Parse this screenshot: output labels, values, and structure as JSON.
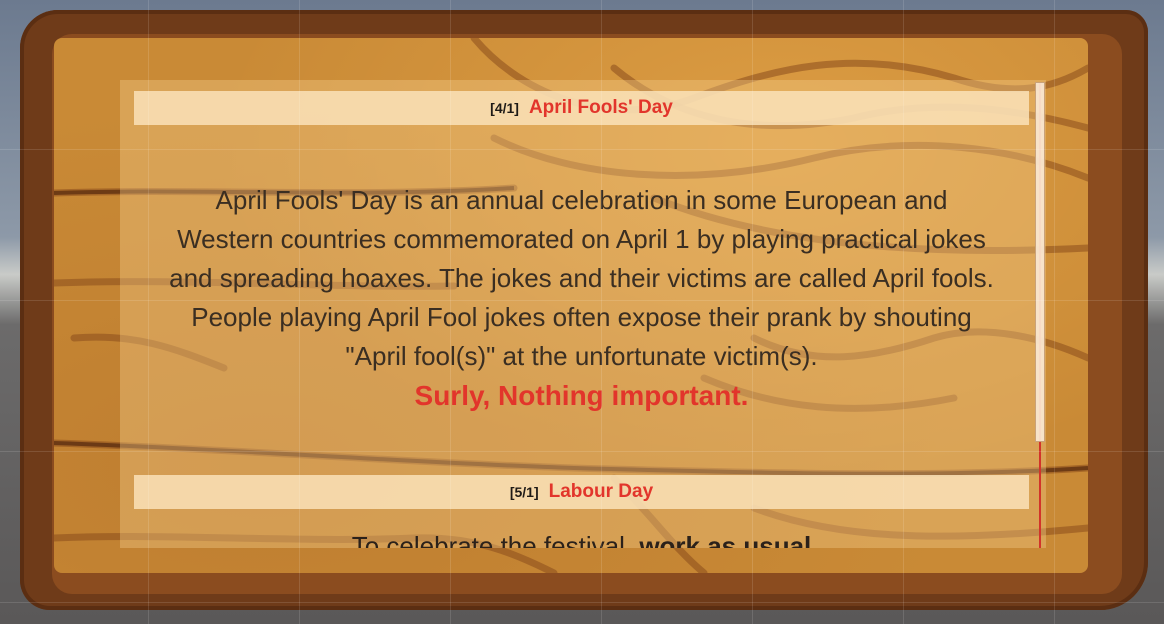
{
  "entries": [
    {
      "date": "[4/1]",
      "title": "April Fools' Day",
      "lines": [
        "April Fools' Day is an annual celebration in some European and",
        "Western countries commemorated on April 1 by playing practical jokes",
        "and spreading hoaxes. The jokes and their victims are called April fools.",
        "People playing April Fool jokes often expose their prank by shouting",
        "\"April fool(s)\" at the unfortunate victim(s)."
      ],
      "emphasis": "Surly, Nothing important."
    },
    {
      "date": "[5/1]",
      "title": "Labour Day",
      "body_prefix": "To celebrate the festival, ",
      "body_emphasis": "work as usual"
    }
  ],
  "colors": {
    "title_red": "#e2352b",
    "text_dark": "#3a2e22",
    "wood_dark": "#6f3b19",
    "wood_light": "#c98a36"
  }
}
